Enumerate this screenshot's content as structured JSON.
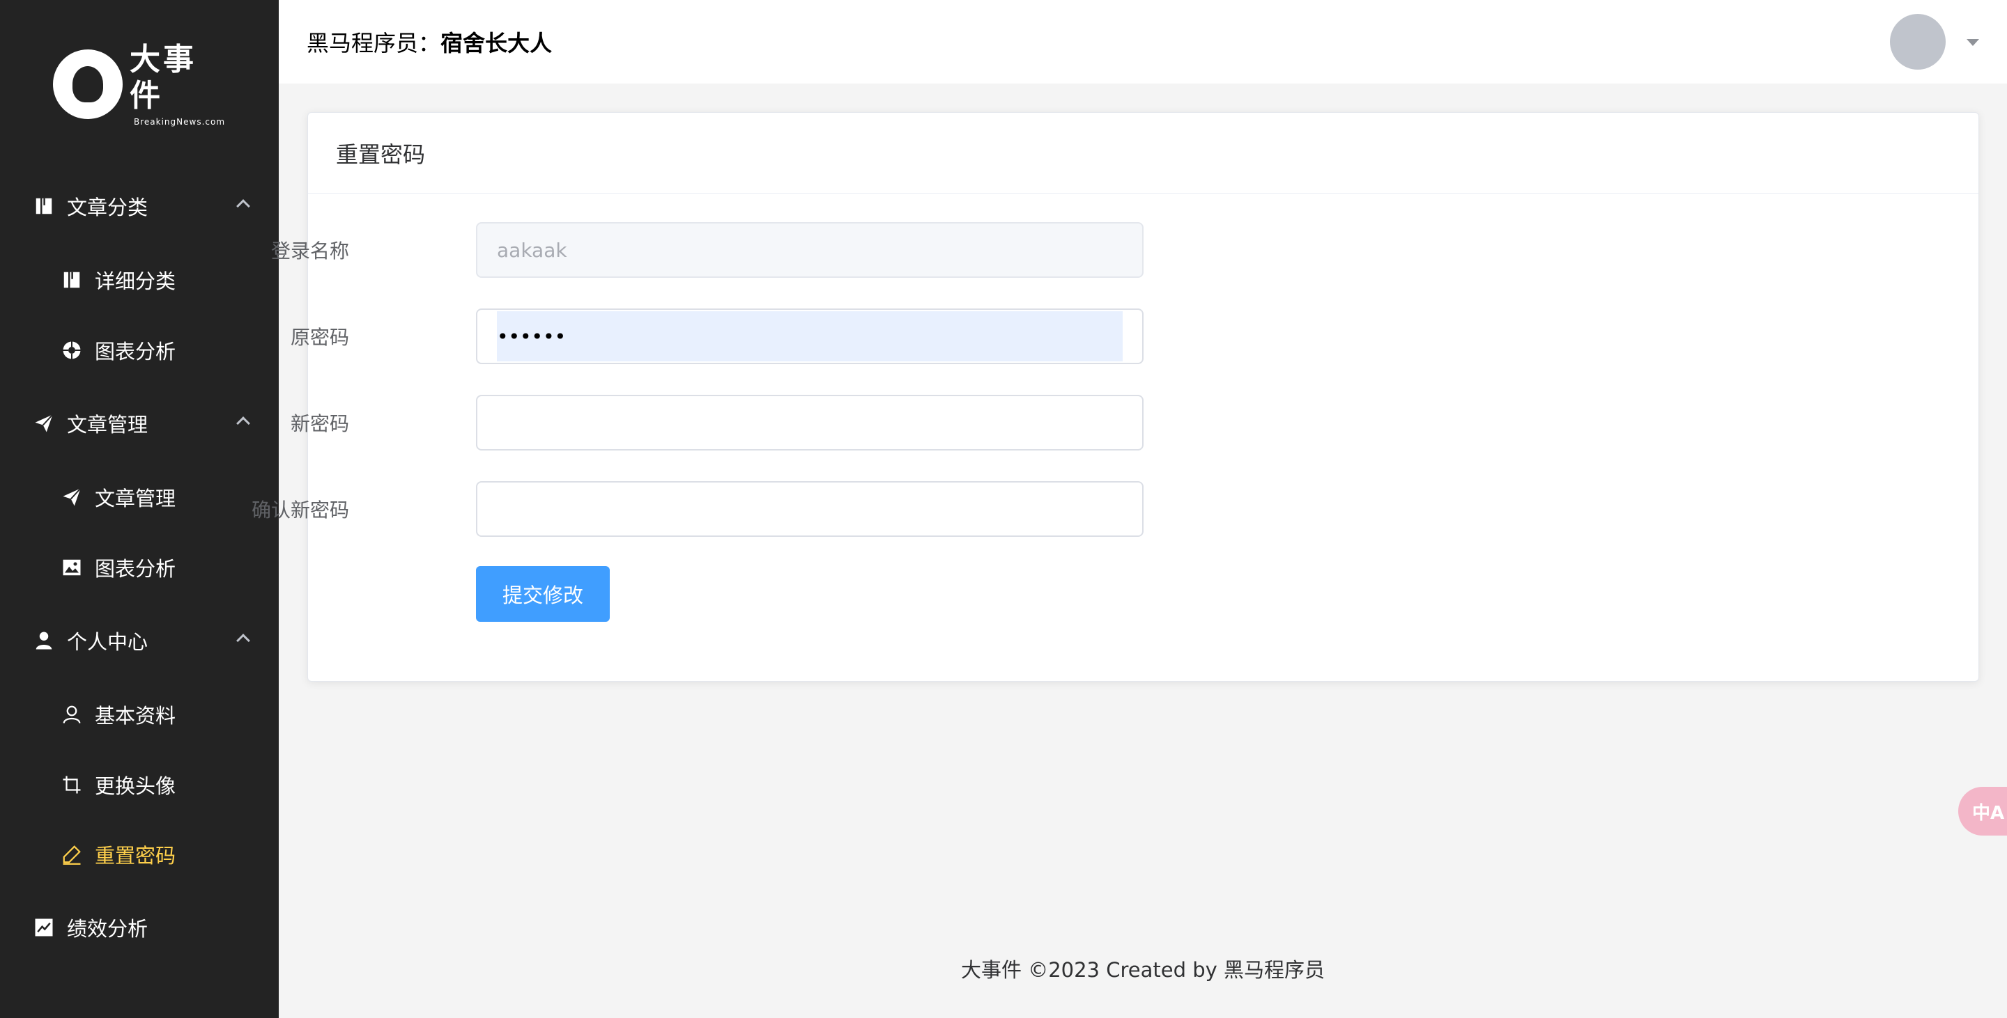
{
  "brand": {
    "title": "大事件",
    "subtitle": "BreakingNews.com"
  },
  "header": {
    "prefix": "黑马程序员：",
    "username": "宿舍长大人"
  },
  "sidebar": {
    "items": [
      {
        "label": "文章分类",
        "icon": "book-icon",
        "level": 1,
        "expanded": true
      },
      {
        "label": "详细分类",
        "icon": "book-icon",
        "level": 2
      },
      {
        "label": "图表分析",
        "icon": "aperture-icon",
        "level": 2
      },
      {
        "label": "文章管理",
        "icon": "send-icon",
        "level": 1,
        "expanded": true
      },
      {
        "label": "文章管理",
        "icon": "send-icon",
        "level": 2
      },
      {
        "label": "图表分析",
        "icon": "image-icon",
        "level": 2
      },
      {
        "label": "个人中心",
        "icon": "user-filled-icon",
        "level": 1,
        "expanded": true
      },
      {
        "label": "基本资料",
        "icon": "user-icon",
        "level": 2
      },
      {
        "label": "更换头像",
        "icon": "crop-icon",
        "level": 2
      },
      {
        "label": "重置密码",
        "icon": "edit-pen-icon",
        "level": 2,
        "active": true
      },
      {
        "label": "绩效分析",
        "icon": "trend-chart-icon",
        "level": 1
      }
    ]
  },
  "card": {
    "title": "重置密码",
    "fields": {
      "login_name": {
        "label": "登录名称",
        "value": "aakaak"
      },
      "old_password": {
        "label": "原密码",
        "value": "••••••"
      },
      "new_password": {
        "label": "新密码",
        "value": ""
      },
      "confirm_password": {
        "label": "确认新密码",
        "value": ""
      }
    },
    "submit_label": "提交修改"
  },
  "footer": {
    "text": "大事件 ©2023 Created by 黑马程序员"
  },
  "translate_widget": {
    "label": "中A"
  },
  "colors": {
    "sidebar_bg": "#232323",
    "active_text": "#ffd04b",
    "primary": "#409eff",
    "page_bg": "#f4f4f4"
  }
}
